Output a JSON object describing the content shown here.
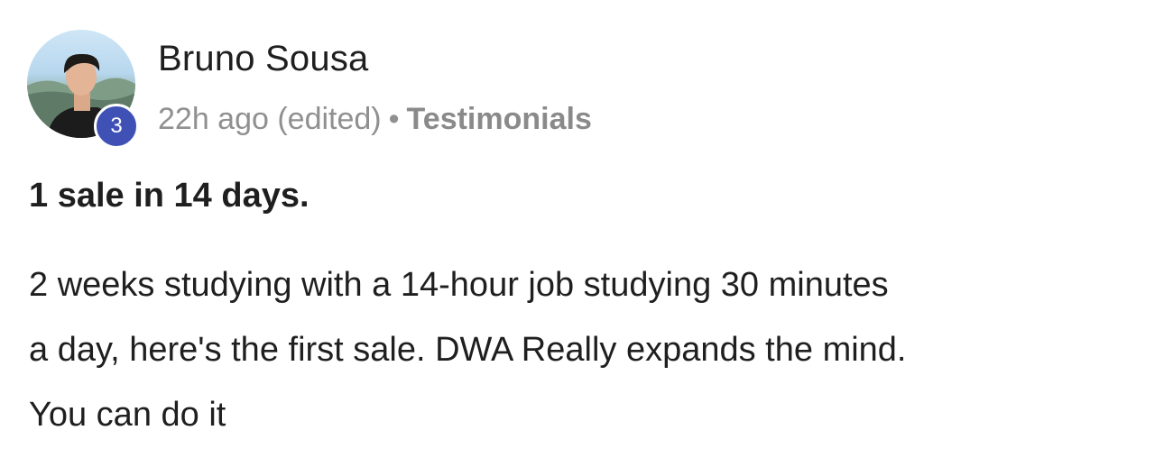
{
  "post": {
    "author": {
      "name": "Bruno Sousa",
      "level": "3"
    },
    "meta": {
      "time": "22h ago (edited)",
      "separator": "•",
      "category": "Testimonials"
    },
    "title": "1 sale in 14 days.",
    "body_lines": [
      "2 weeks studying with a 14-hour job studying 30 minutes",
      "a day, here's the first sale. DWA Really expands the mind.",
      "You can do it"
    ]
  },
  "colors": {
    "badge": "#3f51b5",
    "text": "#1f1f1f",
    "meta": "#909090"
  }
}
